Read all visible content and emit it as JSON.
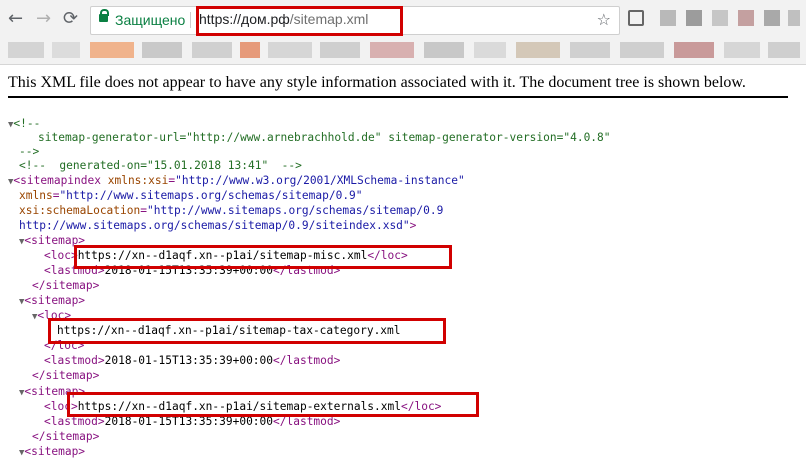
{
  "browser": {
    "nav": {
      "back": "←",
      "forward": "→",
      "reload": "⟳"
    },
    "security_label": "Защищено",
    "url_host": "https://дом.рф",
    "url_path": "/sitemap.xml",
    "star": "☆",
    "colors": {
      "secure": "#0b8043",
      "highlight": "#d10000"
    }
  },
  "page": {
    "notice": "This XML file does not appear to have any style information associated with it. The document tree is shown below."
  },
  "xml": {
    "comment_open": "<!--",
    "generator_line": "sitemap-generator-url=\"http://www.arnebrachhold.de\" sitemap-generator-version=\"4.0.8\"",
    "comment_close": "-->",
    "generated_on": "<!--  generated-on=\"15.01.2018 13:41\"  -->",
    "sitemapindex_open": "<sitemapindex",
    "xmlns_xsi_name": "xmlns:xsi",
    "xmlns_xsi_value": "\"http://www.w3.org/2001/XMLSchema-instance\"",
    "xmlns_name": "xmlns",
    "xmlns_value": "\"http://www.sitemaps.org/schemas/sitemap/0.9\"",
    "schema_loc_name": "xsi:schemaLocation",
    "schema_loc_value1": "\"http://www.sitemaps.org/schemas/sitemap/0.9",
    "schema_loc_value2": "http://www.sitemaps.org/schemas/sitemap/0.9/siteindex.xsd\"",
    "gt": ">",
    "sitemap_open": "<sitemap>",
    "sitemap_close": "</sitemap>",
    "loc_open": "<loc>",
    "loc_close": "</loc>",
    "lastmod_open": "<lastmod>",
    "lastmod_close": "</lastmod>",
    "entries": [
      {
        "loc": "https://xn--d1aqf.xn--p1ai/sitemap-misc.xml",
        "lastmod": "2018-01-15T13:35:39+00:00"
      },
      {
        "loc": "https://xn--d1aqf.xn--p1ai/sitemap-tax-category.xml",
        "lastmod": "2018-01-15T13:35:39+00:00"
      },
      {
        "loc": "https://xn--d1aqf.xn--p1ai/sitemap-externals.xml",
        "lastmod": "2018-01-15T13:35:39+00:00"
      }
    ]
  }
}
